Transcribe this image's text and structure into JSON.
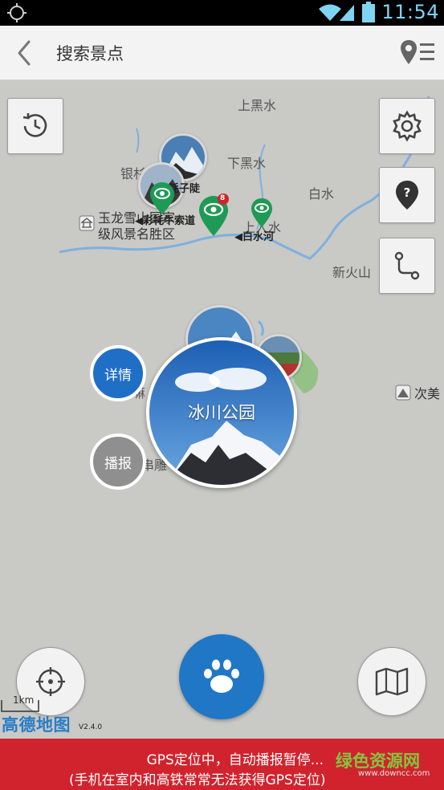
{
  "status_bar": {
    "time": "11:54"
  },
  "header": {
    "title": "搜索景点"
  },
  "map": {
    "places": {
      "shangheishui": "上黑水",
      "xiaheishui": "下黑水",
      "baishui": "白水",
      "yin": "银杉",
      "shangrenshui": "上人水",
      "yulong": "玉龙雪山",
      "yulong_line1": "玉龙雪山国家",
      "yulong_line2": "级风景名胜区",
      "xinhuoshan": "新火山",
      "cime": "次美",
      "yaozilu": "牦子陡",
      "ropeway": "彩牦牛索道",
      "baishuihe": "白水河",
      "left_text1": "嘛",
      "left_text2": "串雕"
    },
    "pin_badge": "8"
  },
  "popup": {
    "spot_title": "冰川公园",
    "detail_label": "详情",
    "broadcast_label": "播报"
  },
  "map_footer": {
    "scale_label": "1km",
    "logo": "高德地图",
    "version": "V2.4.0"
  },
  "banner": {
    "line1": "GPS定位中，自动播报暂停...",
    "line2": "(手机在室内和高铁常常无法获得GPS定位)",
    "watermark": "绿色资源网",
    "watermark_sub": "www.downcc.com"
  },
  "colors": {
    "accent_blue": "#1f77c6",
    "banner_red": "#d0232d",
    "pin_green": "#1e9a55",
    "river_blue": "#7fb0dd"
  }
}
